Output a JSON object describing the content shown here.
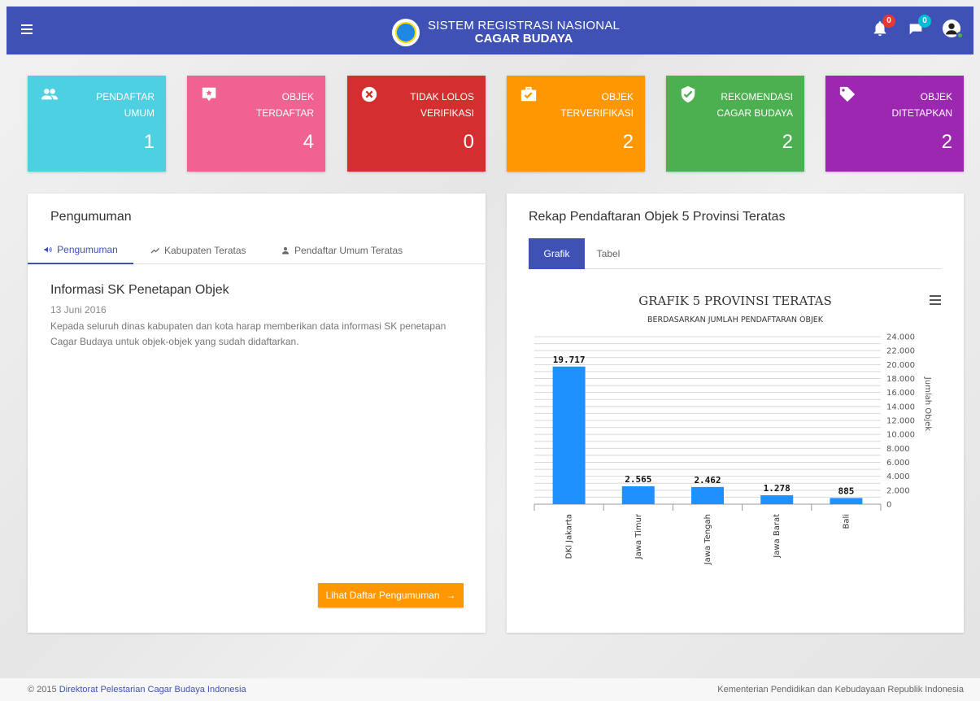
{
  "header": {
    "title_line1": "SISTEM REGISTRASI NASIONAL",
    "title_line2": "CAGAR BUDAYA",
    "notif_count": "0",
    "message_count": "0"
  },
  "cards": [
    {
      "title1": "PENDAFTAR",
      "title2": "UMUM",
      "value": "1",
      "color": "#4dd0e1",
      "icon": "users-icon"
    },
    {
      "title1": "OBJEK",
      "title2": "TERDAFTAR",
      "value": "4",
      "color": "#f06292",
      "icon": "star-box-icon"
    },
    {
      "title1": "TIDAK LOLOS",
      "title2": "VERIFIKASI",
      "value": "0",
      "color": "#d32f2f",
      "icon": "close-circle-icon"
    },
    {
      "title1": "OBJEK",
      "title2": "TERVERIFIKASI",
      "value": "2",
      "color": "#ff9800",
      "icon": "briefcase-check-icon"
    },
    {
      "title1": "REKOMENDASI",
      "title2": "CAGAR BUDAYA",
      "value": "2",
      "color": "#4caf50",
      "icon": "shield-check-icon"
    },
    {
      "title1": "OBJEK",
      "title2": "DITETAPKAN",
      "value": "2",
      "color": "#9c27b0",
      "icon": "tag-icon"
    }
  ],
  "left_panel": {
    "title": "Pengumuman",
    "tabs": [
      "Pengumuman",
      "Kabupaten Teratas",
      "Pendaftar Umum Teratas"
    ],
    "announcement": {
      "title": "Informasi SK Penetapan Objek",
      "date": "13 Juni 2016",
      "body": "Kepada seluruh dinas kabupaten dan kota harap memberikan data informasi SK penetapan Cagar Budaya untuk objek-objek yang sudah didaftarkan."
    },
    "button_label": "Lihat Daftar Pengumuman"
  },
  "right_panel": {
    "title": "Rekap Pendaftaran Objek 5 Provinsi Teratas",
    "tabs": [
      "Grafik",
      "Tabel"
    ]
  },
  "chart_data": {
    "type": "bar",
    "title": "GRAFIK 5 PROVINSI TERATAS",
    "subtitle": "BERDASARKAN JUMLAH PENDAFTARAN OBJEK",
    "categories": [
      "DKI Jakarta",
      "Jawa Timur",
      "Jawa Tengah",
      "Jawa Barat",
      "Bali"
    ],
    "values": [
      19717,
      2565,
      2462,
      1278,
      885
    ],
    "value_labels": [
      "19.717",
      "2.565",
      "2.462",
      "1.278",
      "885"
    ],
    "ylabel": "Jumlah Objek",
    "ylim": [
      0,
      24000
    ],
    "yticks": [
      "0",
      "2.000",
      "4.000",
      "6.000",
      "8.000",
      "10.000",
      "12.000",
      "14.000",
      "16.000",
      "18.000",
      "20.000",
      "22.000",
      "24.000"
    ],
    "y_axis_side": "right",
    "bar_color": "#1e90ff"
  },
  "footer": {
    "copyright": "© 2015",
    "org_link": "Direktorat Pelestarian Cagar Budaya Indonesia",
    "right_text": "Kementerian Pendidikan dan Kebudayaan Republik Indonesia"
  }
}
